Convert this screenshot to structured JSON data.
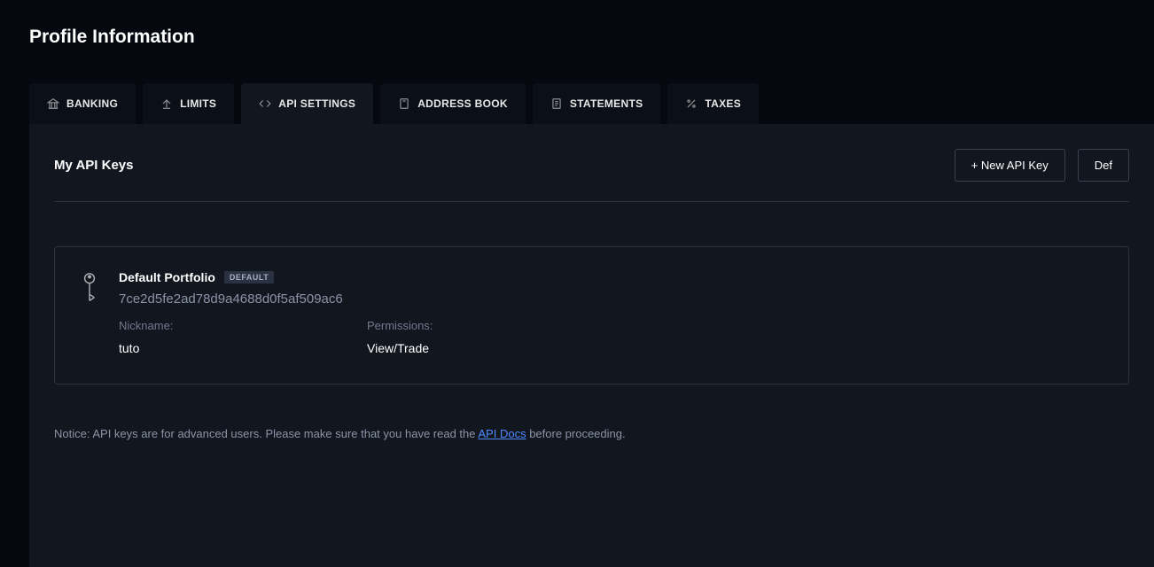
{
  "page": {
    "title": "Profile Information"
  },
  "tabs": [
    {
      "label": "BANKING"
    },
    {
      "label": "LIMITS"
    },
    {
      "label": "API SETTINGS"
    },
    {
      "label": "ADDRESS BOOK"
    },
    {
      "label": "STATEMENTS"
    },
    {
      "label": "TAXES"
    }
  ],
  "panel": {
    "title": "My API Keys",
    "newKeyBtn": "+ New API Key",
    "defaultBtn": "Def"
  },
  "apiKey": {
    "portfolio": "Default Portfolio",
    "badge": "DEFAULT",
    "key": "7ce2d5fe2ad78d9a4688d0f5af509ac6",
    "nicknameLabel": "Nickname:",
    "nickname": "tuto",
    "permissionsLabel": "Permissions:",
    "permissions": "View/Trade"
  },
  "notice": {
    "prefix": "Notice: API keys are for advanced users. Please make sure that you have read the ",
    "link": "API Docs",
    "suffix": " before proceeding."
  }
}
